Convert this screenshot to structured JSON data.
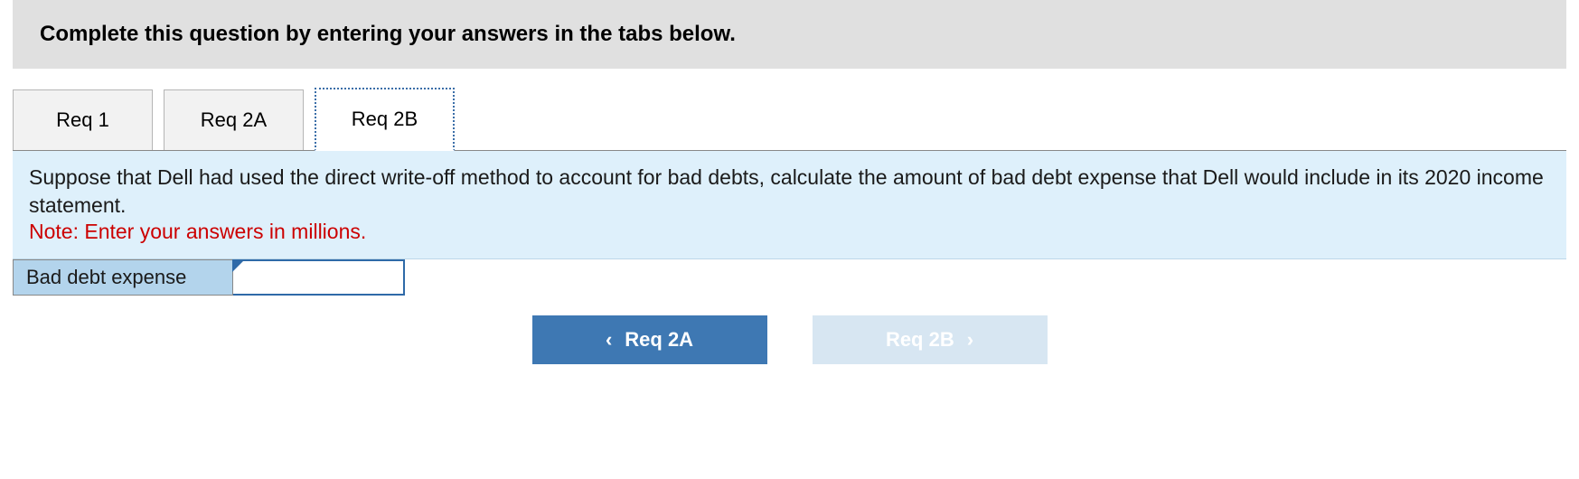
{
  "header": {
    "instruction": "Complete this question by entering your answers in the tabs below."
  },
  "tabs": [
    {
      "label": "Req 1"
    },
    {
      "label": "Req 2A"
    },
    {
      "label": "Req 2B"
    }
  ],
  "panel": {
    "body": "Suppose that Dell had used the direct write-off method to account for bad debts, calculate the amount of bad debt expense that Dell would include in its 2020 income statement.",
    "note": "Note: Enter your answers in millions."
  },
  "answer": {
    "label": "Bad debt expense",
    "value": ""
  },
  "nav": {
    "prev_label": "Req 2A",
    "next_label": "Req 2B",
    "prev_icon": "‹",
    "next_icon": "›"
  }
}
